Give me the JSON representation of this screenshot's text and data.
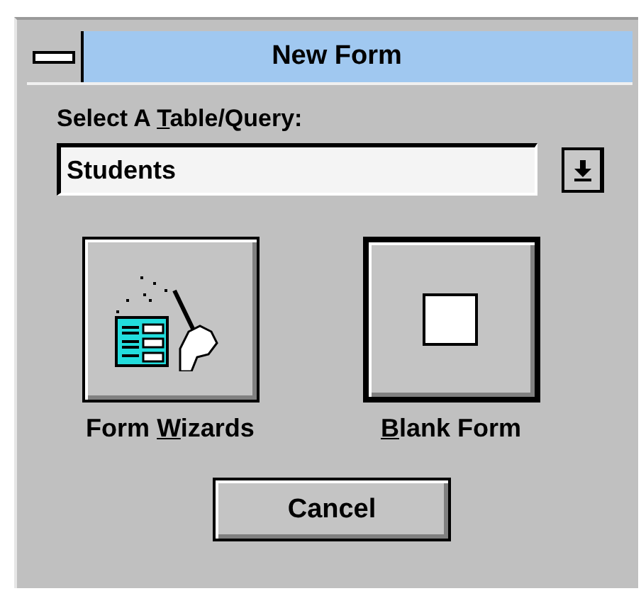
{
  "window": {
    "title": "New Form"
  },
  "table_query": {
    "label": {
      "before": "Select A ",
      "key": "T",
      "after": "able/Query:"
    },
    "value": "Students"
  },
  "choices": [
    {
      "kind": "wizard",
      "label": {
        "before": "Form ",
        "key": "W",
        "after": "izards"
      },
      "default": false
    },
    {
      "kind": "blank",
      "label": {
        "key": "B",
        "after": "lank Form"
      },
      "default": true
    }
  ],
  "buttons": [
    {
      "label": "Cancel"
    }
  ]
}
